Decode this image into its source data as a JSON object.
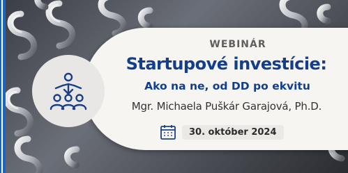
{
  "banner": {
    "label": "WEBINÁR",
    "title": "Startupové investície:",
    "subtitle": "Ako na ne, od DD po ekvitu",
    "speaker": "Mgr. Michaela Puškár Garajová, Ph.D.",
    "date": "30. október 2024",
    "icons": {
      "team": "team-presentation-icon",
      "calendar": "calendar-icon"
    },
    "colors": {
      "title": "#123e8b",
      "card": "#f7f5f2",
      "frame": "#1a66c0"
    }
  }
}
